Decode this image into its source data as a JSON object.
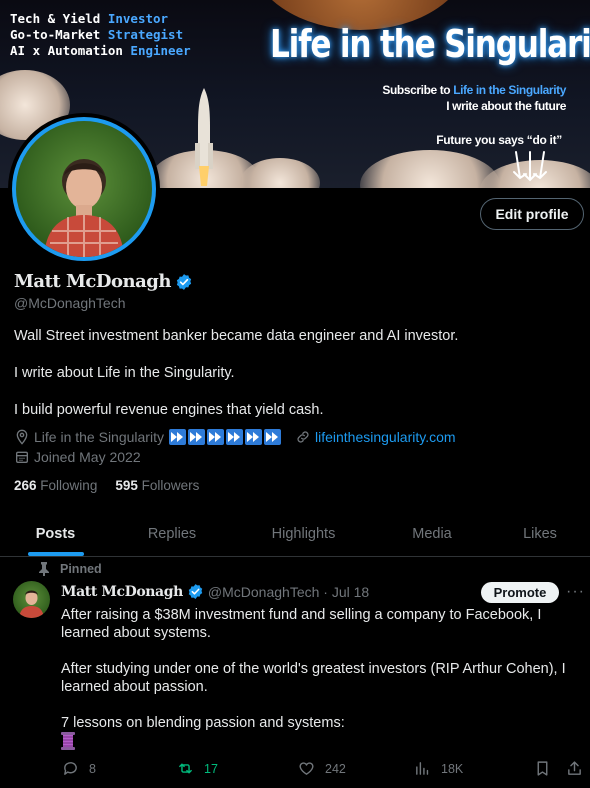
{
  "banner": {
    "tagline": [
      {
        "text": "Tech & Yield ",
        "accent": "Investor"
      },
      {
        "text": "Go-to-Market ",
        "accent": "Strategist"
      },
      {
        "text": "AI x Automation ",
        "accent": "Engineer"
      }
    ],
    "title": "Life in the Singularity",
    "subscribe_prefix": "Subscribe to ",
    "subscribe_link": "Life in the Singularity",
    "write_line": "I write about the future",
    "future_line": "Future you says “do it”"
  },
  "profile": {
    "edit_label": "Edit profile",
    "name": "Matt McDonagh",
    "handle": "@McDonaghTech",
    "bio": [
      "Wall Street investment banker became data engineer and AI investor.",
      "I write about Life in the Singularity.",
      "I build powerful revenue engines that yield cash."
    ],
    "location": "Life in the Singularity",
    "website": "lifeinthesingularity.com",
    "joined": "Joined May 2022",
    "following_count": "266",
    "following_label": "Following",
    "followers_count": "595",
    "followers_label": "Followers"
  },
  "tabs": [
    {
      "label": "Posts",
      "active": true
    },
    {
      "label": "Replies"
    },
    {
      "label": "Highlights"
    },
    {
      "label": "Media"
    },
    {
      "label": "Likes"
    }
  ],
  "post": {
    "pinned_label": "Pinned",
    "author": "Matt McDonagh",
    "handle_date": "@McDonaghTech · Jul 18",
    "promote_label": "Promote",
    "more_label": "···",
    "paragraphs": [
      "After raising a $38M investment fund and selling a company to Facebook, I learned about systems.",
      "After studying under one of the world's greatest investors (RIP Arthur Cohen), I learned about passion.",
      "7 lessons on blending passion and systems:"
    ],
    "replies": "8",
    "reposts": "17",
    "likes": "242",
    "views": "18K"
  },
  "colors": {
    "accent": "#1d9bf0",
    "repost": "#00ba7c",
    "muted": "#71767b",
    "background": "#000000"
  }
}
